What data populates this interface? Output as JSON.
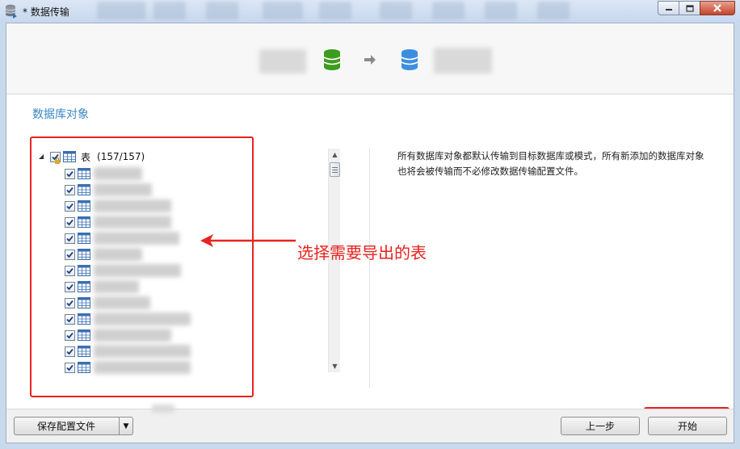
{
  "window": {
    "title": "* 数据传输",
    "controls": [
      "minimize-icon",
      "maximize-icon",
      "close-icon"
    ]
  },
  "section": {
    "label": "数据库对象"
  },
  "header": {
    "source_icon": "database-icon",
    "source_color": "#3d9c1f",
    "transfer_icon": "arrow-right-icon",
    "target_icon": "database-icon",
    "target_color": "#3c8fe0"
  },
  "tree": {
    "root": {
      "label": "表",
      "count": "(157/157)",
      "checked": true,
      "expanded": true
    },
    "visible_rows": 13,
    "all_checked": true
  },
  "description": "所有数据库对象都默认传输到目标数据库或模式，所有新添加的数据库对象也将会被传输而不必修改数据传输配置文件。",
  "annotation": {
    "text": "选择需要导出的表",
    "color": "#e8231f"
  },
  "footer": {
    "save_config_label": "保存配置文件",
    "prev_label": "上一步",
    "start_label": "开始"
  }
}
